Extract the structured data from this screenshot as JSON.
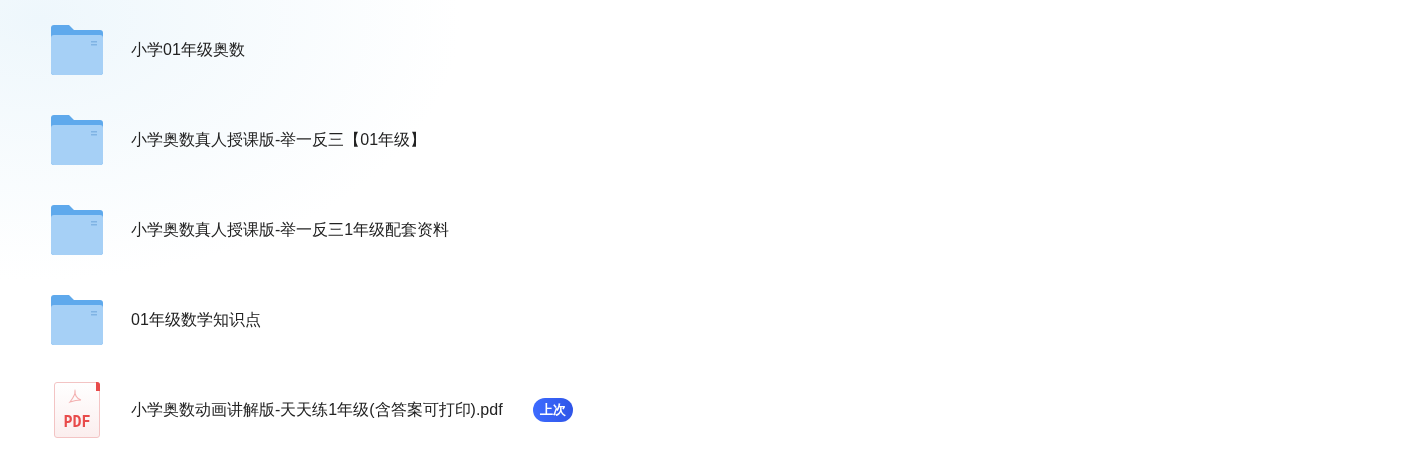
{
  "files": [
    {
      "kind": "folder",
      "name": "小学01年级奥数"
    },
    {
      "kind": "folder",
      "name": "小学奥数真人授课版-举一反三【01年级】"
    },
    {
      "kind": "folder",
      "name": "小学奥数真人授课版-举一反三1年级配套资料"
    },
    {
      "kind": "folder",
      "name": "01年级数学知识点"
    },
    {
      "kind": "pdf",
      "name": "小学奥数动画讲解版-天天练1年级(含答案可打印).pdf",
      "icon_label": "PDF",
      "badge": "上次"
    }
  ]
}
